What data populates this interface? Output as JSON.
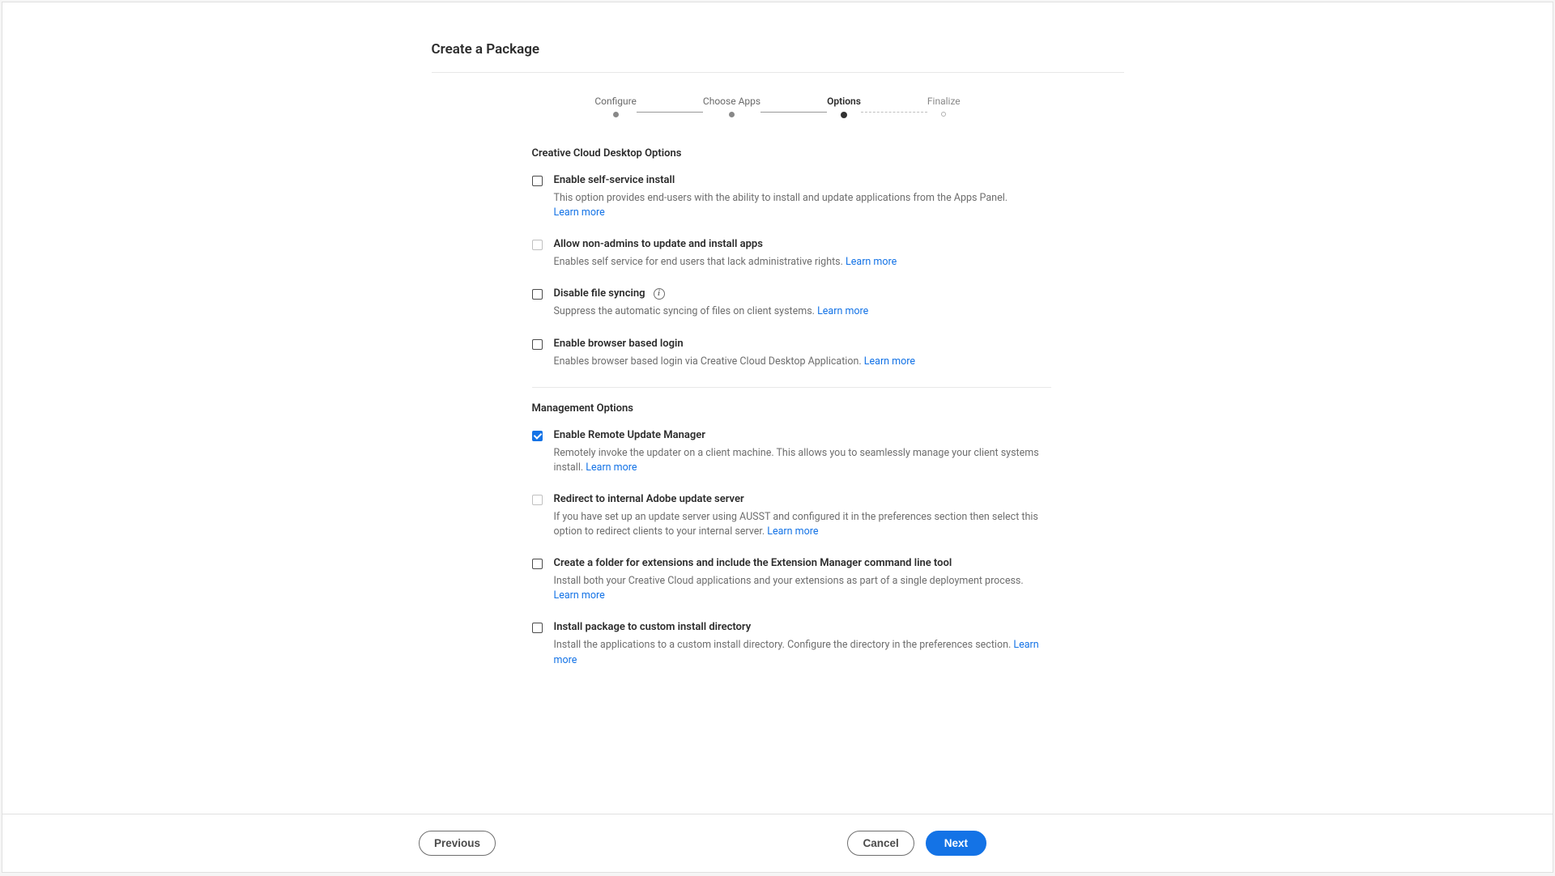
{
  "page_title": "Create a Package",
  "stepper": {
    "steps": [
      {
        "label": "Configure",
        "state": "completed"
      },
      {
        "label": "Choose Apps",
        "state": "completed"
      },
      {
        "label": "Options",
        "state": "active"
      },
      {
        "label": "Finalize",
        "state": "future"
      }
    ]
  },
  "sections": {
    "cc_desktop": {
      "title": "Creative Cloud Desktop Options",
      "options": {
        "self_service": {
          "label": "Enable self-service install",
          "desc": "This option provides end-users with the ability to install and update applications from the Apps Panel.",
          "learn_more": "Learn more",
          "checked": false,
          "disabled": false
        },
        "non_admins": {
          "label": "Allow non-admins to update and install apps",
          "desc": "Enables self service for end users that lack administrative rights.",
          "learn_more": "Learn more",
          "checked": false,
          "disabled": true
        },
        "disable_sync": {
          "label": "Disable file syncing",
          "desc": "Suppress the automatic syncing of files on client systems.",
          "learn_more": "Learn more",
          "checked": false,
          "disabled": false
        },
        "browser_login": {
          "label": "Enable browser based login",
          "desc": "Enables browser based login via Creative Cloud Desktop Application.",
          "learn_more": "Learn more",
          "checked": false,
          "disabled": false
        }
      }
    },
    "management": {
      "title": "Management Options",
      "options": {
        "rum": {
          "label": "Enable Remote Update Manager",
          "desc": "Remotely invoke the updater on a client machine. This allows you to seamlessly manage your client systems install.",
          "learn_more": "Learn more",
          "checked": true,
          "disabled": false
        },
        "redirect": {
          "label": "Redirect to internal Adobe update server",
          "desc": "If you have set up an update server using AUSST and configured it in the preferences section then select this option to redirect clients to your internal server.",
          "learn_more": "Learn more",
          "checked": false,
          "disabled": true
        },
        "ext_folder": {
          "label": "Create a folder for extensions and include the Extension Manager command line tool",
          "desc": "Install both your Creative Cloud applications and your extensions as part of a single deployment process.",
          "learn_more": "Learn more",
          "checked": false,
          "disabled": false
        },
        "custom_dir": {
          "label": "Install package to custom install directory",
          "desc": "Install the applications to a custom install directory. Configure the directory in the preferences section.",
          "learn_more": "Learn more",
          "checked": false,
          "disabled": false
        }
      }
    }
  },
  "footer": {
    "previous": "Previous",
    "cancel": "Cancel",
    "next": "Next"
  }
}
